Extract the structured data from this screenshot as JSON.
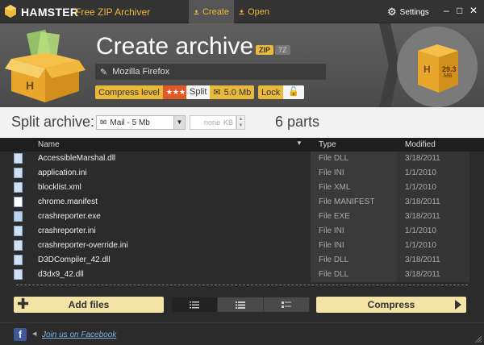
{
  "titlebar": {
    "app_name": "HAMSTER",
    "app_subtitle": "Free ZIP Archiver",
    "tabs": [
      {
        "label": "Create",
        "active": true
      },
      {
        "label": "Open",
        "active": false
      }
    ],
    "settings_label": "Settings"
  },
  "header": {
    "title": "Create archive",
    "formats": [
      "ZIP",
      "7Z"
    ],
    "archive_name": "Mozilla Firefox",
    "compress_label": "Compress level",
    "compress_stars": "★★★",
    "split_label": "Split",
    "split_value": "5.0 Mb",
    "lock_label": "Lock",
    "box_size": "29.3",
    "box_unit": "MB",
    "box_letter": "H"
  },
  "splitbar": {
    "label": "Split archive:",
    "selected_option": "Mail - 5 Mb",
    "size_placeholder": "none",
    "size_unit": "KB",
    "parts_text": "6 parts"
  },
  "table": {
    "columns": [
      "Name",
      "Type",
      "Modified"
    ],
    "rows": [
      {
        "name": "AccessibleMarshal.dll",
        "type": "File DLL",
        "modified": "3/18/2011",
        "icon": "dll-file-icon"
      },
      {
        "name": "application.ini",
        "type": "File INI",
        "modified": "1/1/2010",
        "icon": "ini-file-icon"
      },
      {
        "name": "blocklist.xml",
        "type": "File XML",
        "modified": "1/1/2010",
        "icon": "xml-file-icon"
      },
      {
        "name": "chrome.manifest",
        "type": "File MANIFEST",
        "modified": "3/18/2011",
        "icon": "file-icon"
      },
      {
        "name": "crashreporter.exe",
        "type": "File EXE",
        "modified": "3/18/2011",
        "icon": "exe-file-icon"
      },
      {
        "name": "crashreporter.ini",
        "type": "File INI",
        "modified": "1/1/2010",
        "icon": "ini-file-icon"
      },
      {
        "name": "crashreporter-override.ini",
        "type": "File INI",
        "modified": "1/1/2010",
        "icon": "ini-file-icon"
      },
      {
        "name": "D3DCompiler_42.dll",
        "type": "File DLL",
        "modified": "3/18/2011",
        "icon": "dll-file-icon"
      },
      {
        "name": "d3dx9_42.dll",
        "type": "File DLL",
        "modified": "3/18/2011",
        "icon": "dll-file-icon"
      }
    ]
  },
  "actions": {
    "add_files_label": "Add files",
    "compress_label": "Compress"
  },
  "footer": {
    "facebook_letter": "f",
    "facebook_link": "Join us on Facebook"
  },
  "colors": {
    "accent": "#e8b93a",
    "button_bg": "#f3e3a6",
    "stars_bg": "#e05a28",
    "link": "#7fb0e8"
  }
}
